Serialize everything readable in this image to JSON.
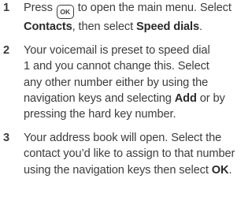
{
  "steps": [
    {
      "number": "1",
      "line1_before": "Press",
      "ok_key_label": "OK",
      "line1_after": "to open the main menu. Select",
      "line2_bold1": "Contacts",
      "line2_mid": ", then select",
      "line2_bold2": "Speed dials",
      "line2_end": "."
    },
    {
      "number": "2",
      "lines": [
        "Your voicemail is preset to speed dial",
        "1 and you cannot change this. Select",
        "any other number either by using the"
      ],
      "line4_before": "navigation keys and selecting",
      "line4_bold": "Add",
      "line4_after": "or by",
      "line5": "pressing the hard key number."
    },
    {
      "number": "3",
      "lines": [
        "Your address book will open. Select the",
        "contact you’d like to assign to that number"
      ],
      "line3_before": "using the navigation keys then select",
      "line3_bold": "OK",
      "line3_end": "."
    }
  ]
}
